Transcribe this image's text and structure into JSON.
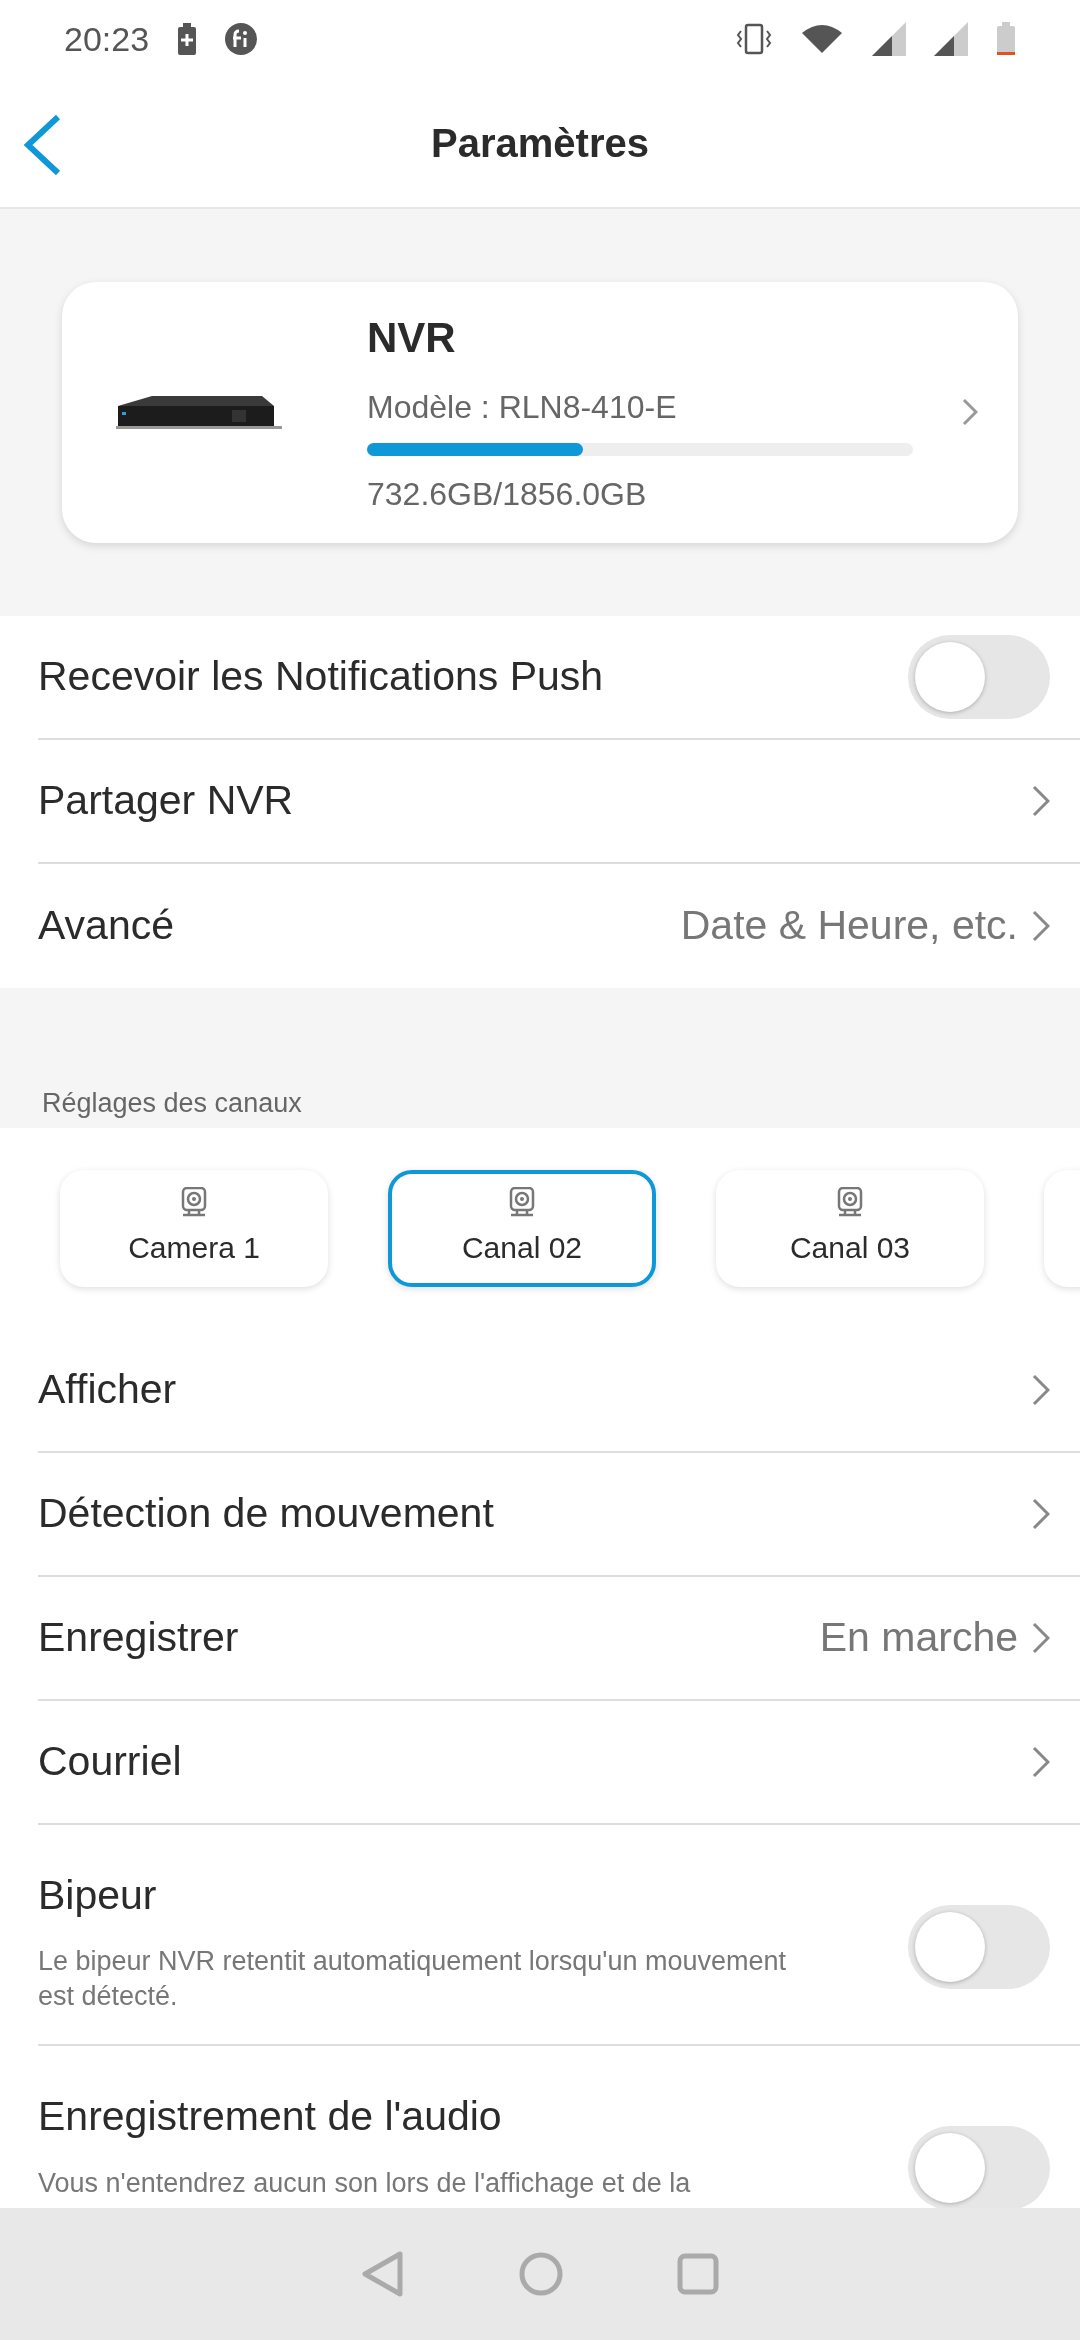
{
  "status_bar": {
    "time": "20:23"
  },
  "header": {
    "title": "Paramètres"
  },
  "device": {
    "kind": "picture",
    "name": "NVR",
    "model": "Modèle : RLN8-410-E",
    "level": 0.395,
    "storage": "732.6GB/1856.0GB"
  },
  "general_rows": [
    {
      "kind": "toggle",
      "label": "Recevoir les Notifications Push",
      "on": false
    },
    {
      "kind": "link",
      "label": "Partager NVR"
    },
    {
      "kind": "link",
      "label": "Avancé",
      "value": "Date & Heure, etc."
    }
  ],
  "channel_section": {
    "title": "Réglages des canaux"
  },
  "channel_tabs": [
    {
      "label": "Camera 1",
      "selected": false
    },
    {
      "label": "Canal 02",
      "selected": true
    },
    {
      "label": "Canal 03",
      "selected": false
    }
  ],
  "channel_rows": [
    {
      "kind": "link",
      "label": "Afficher"
    },
    {
      "kind": "link",
      "label": "Détection de mouvement"
    },
    {
      "kind": "link",
      "label": "Enregistrer",
      "value": "En marche"
    },
    {
      "kind": "link",
      "label": "Courriel"
    },
    {
      "kind": "toggle",
      "label": "Bipeur",
      "description": "Le bipeur NVR retentit automatiquement lorsqu'un mouvement est détecté.",
      "on": false
    },
    {
      "kind": "toggle",
      "label": "Enregistrement de l'audio",
      "description": "Vous n'entendrez aucun son lors de l'affichage et de la",
      "on": false
    }
  ]
}
